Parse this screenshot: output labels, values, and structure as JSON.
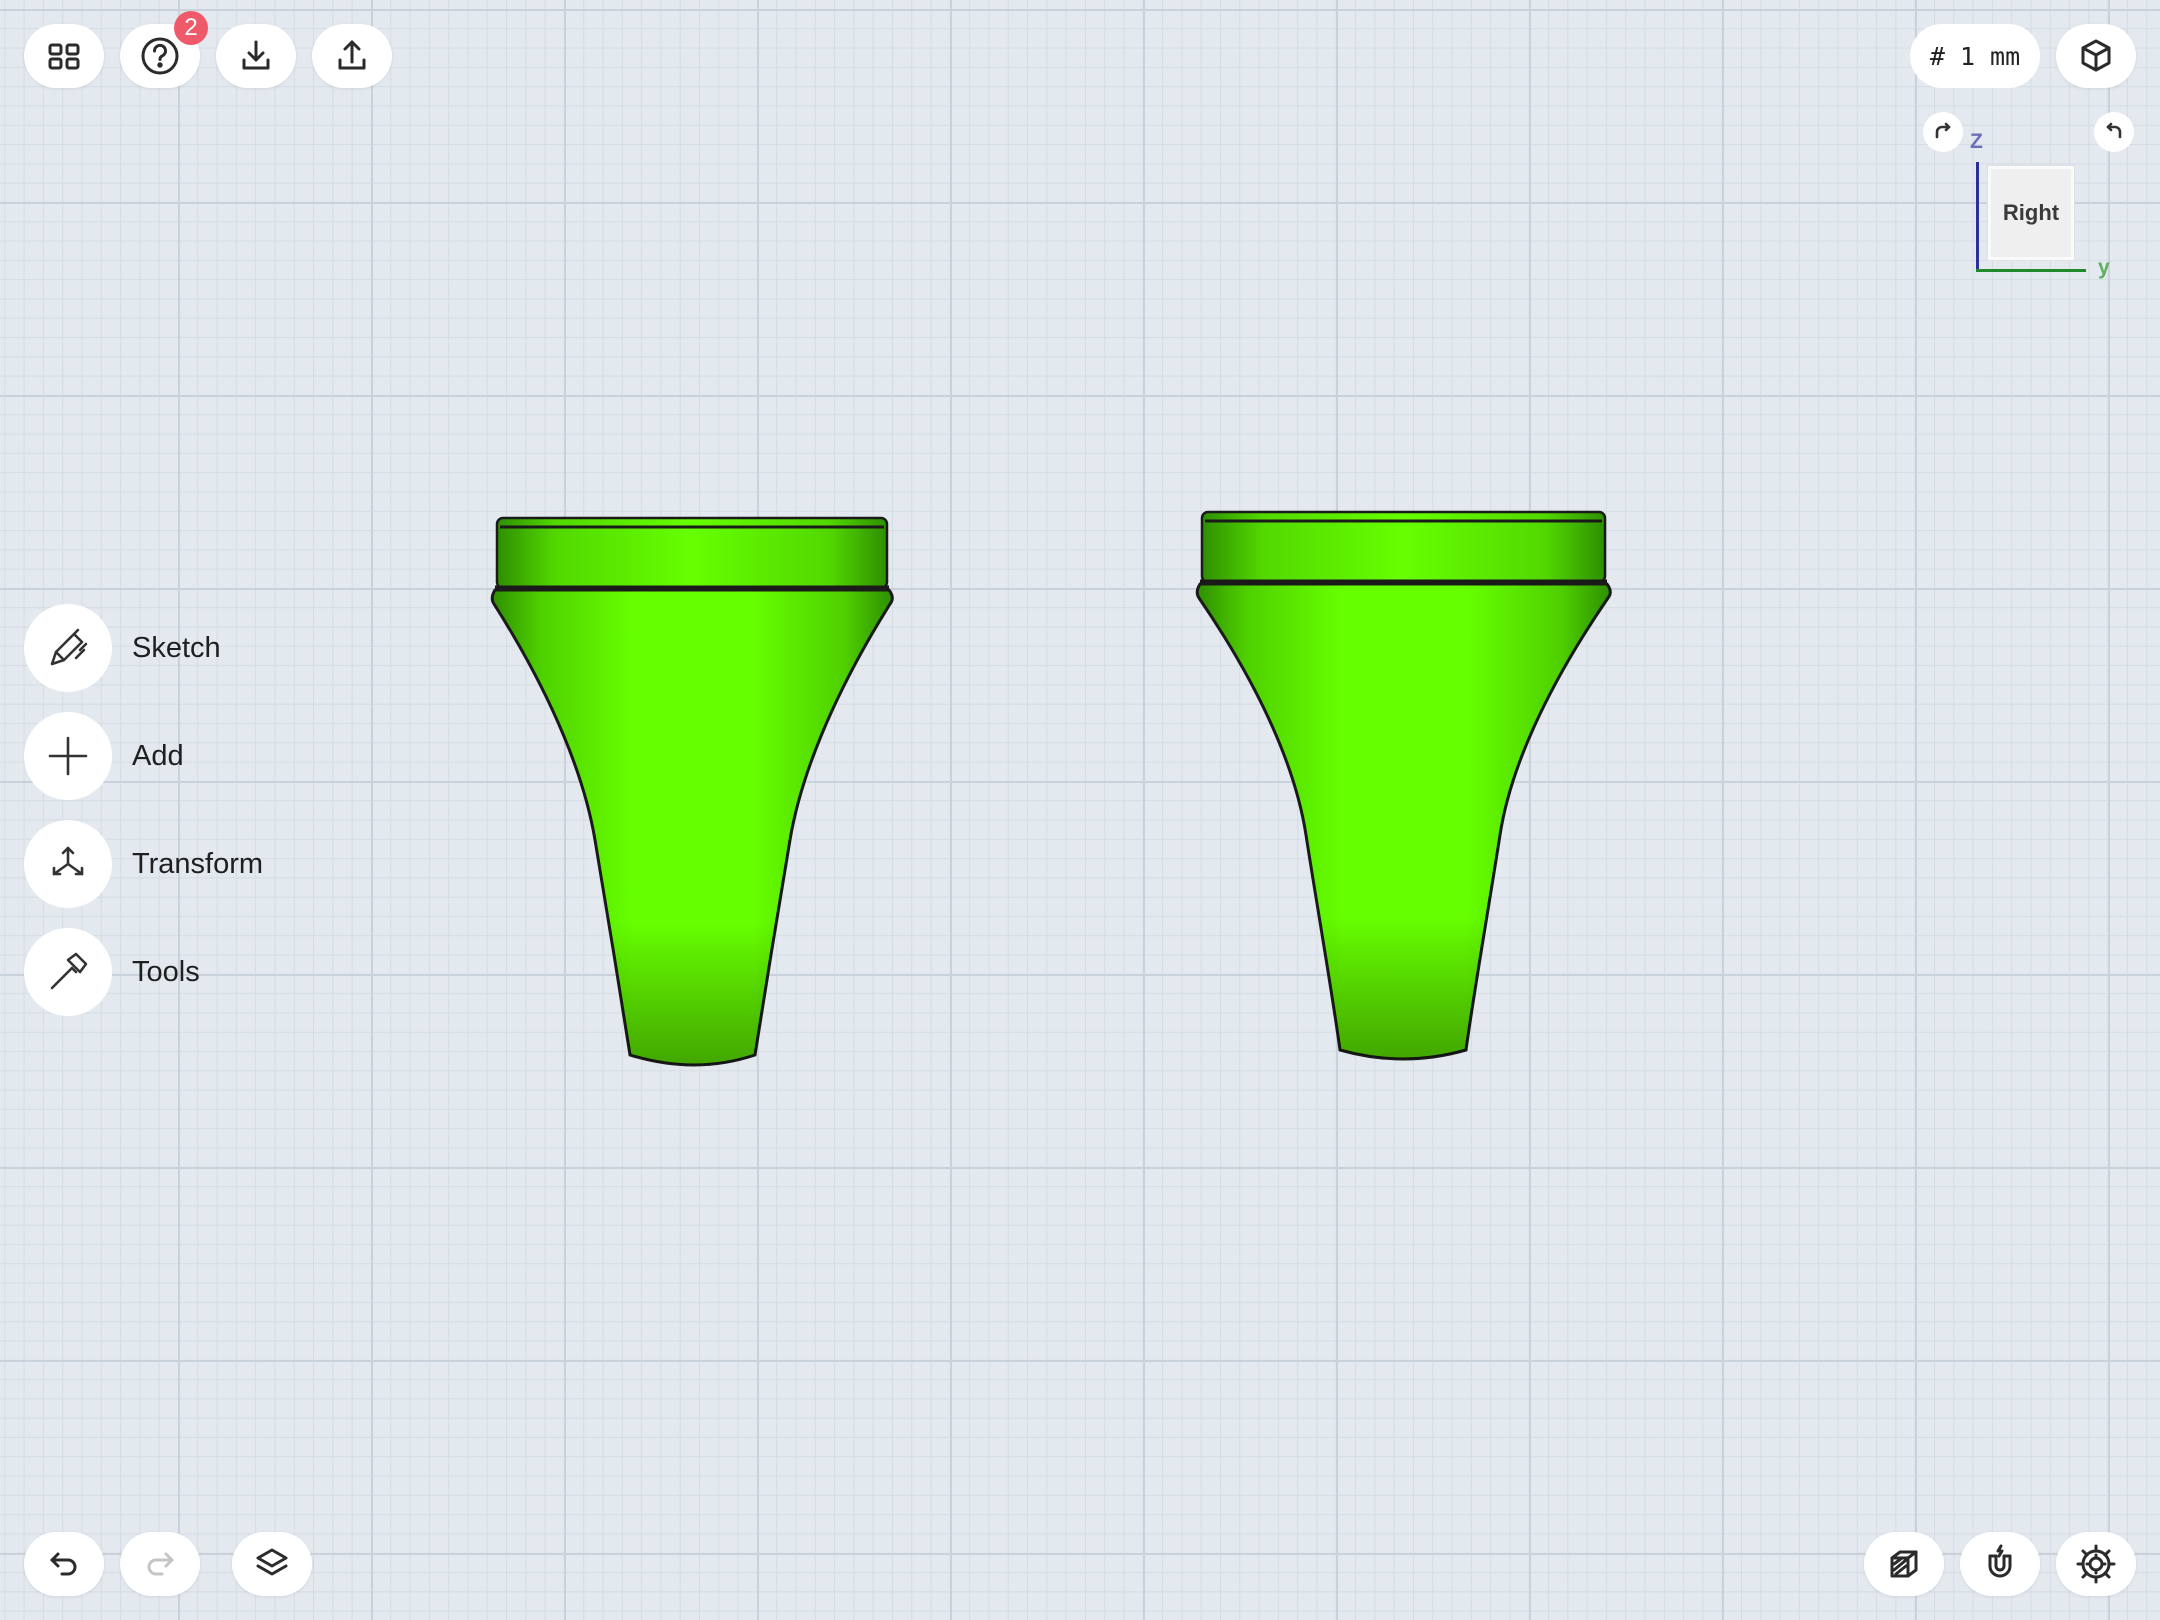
{
  "toolbar_top": {
    "gallery_icon": "grid-icon",
    "help_icon": "help-icon",
    "help_badge": "2",
    "import_icon": "download-icon",
    "export_icon": "share-icon"
  },
  "units": {
    "label": "# 1 mm"
  },
  "viewcube": {
    "face_label": "Right",
    "z_axis": "Z",
    "y_axis": "y",
    "z_color": "#2b2f9c",
    "y_color": "#1f8a2a"
  },
  "side_menu": {
    "items": [
      {
        "label": "Sketch",
        "icon": "pen-icon"
      },
      {
        "label": "Add",
        "icon": "plus-icon"
      },
      {
        "label": "Transform",
        "icon": "transform-arrows-icon"
      },
      {
        "label": "Tools",
        "icon": "hammer-icon"
      }
    ]
  },
  "toolbar_bottom": {
    "undo_icon": "undo-icon",
    "redo_icon": "redo-icon",
    "layers_icon": "layers-icon",
    "render_icon": "shaded-box-icon",
    "snap_icon": "magnet-icon",
    "settings_icon": "gear-icon"
  },
  "colors": {
    "model_fill": "#66ff00",
    "model_shadow": "#2f9a00",
    "outline": "#1a1a1a"
  }
}
